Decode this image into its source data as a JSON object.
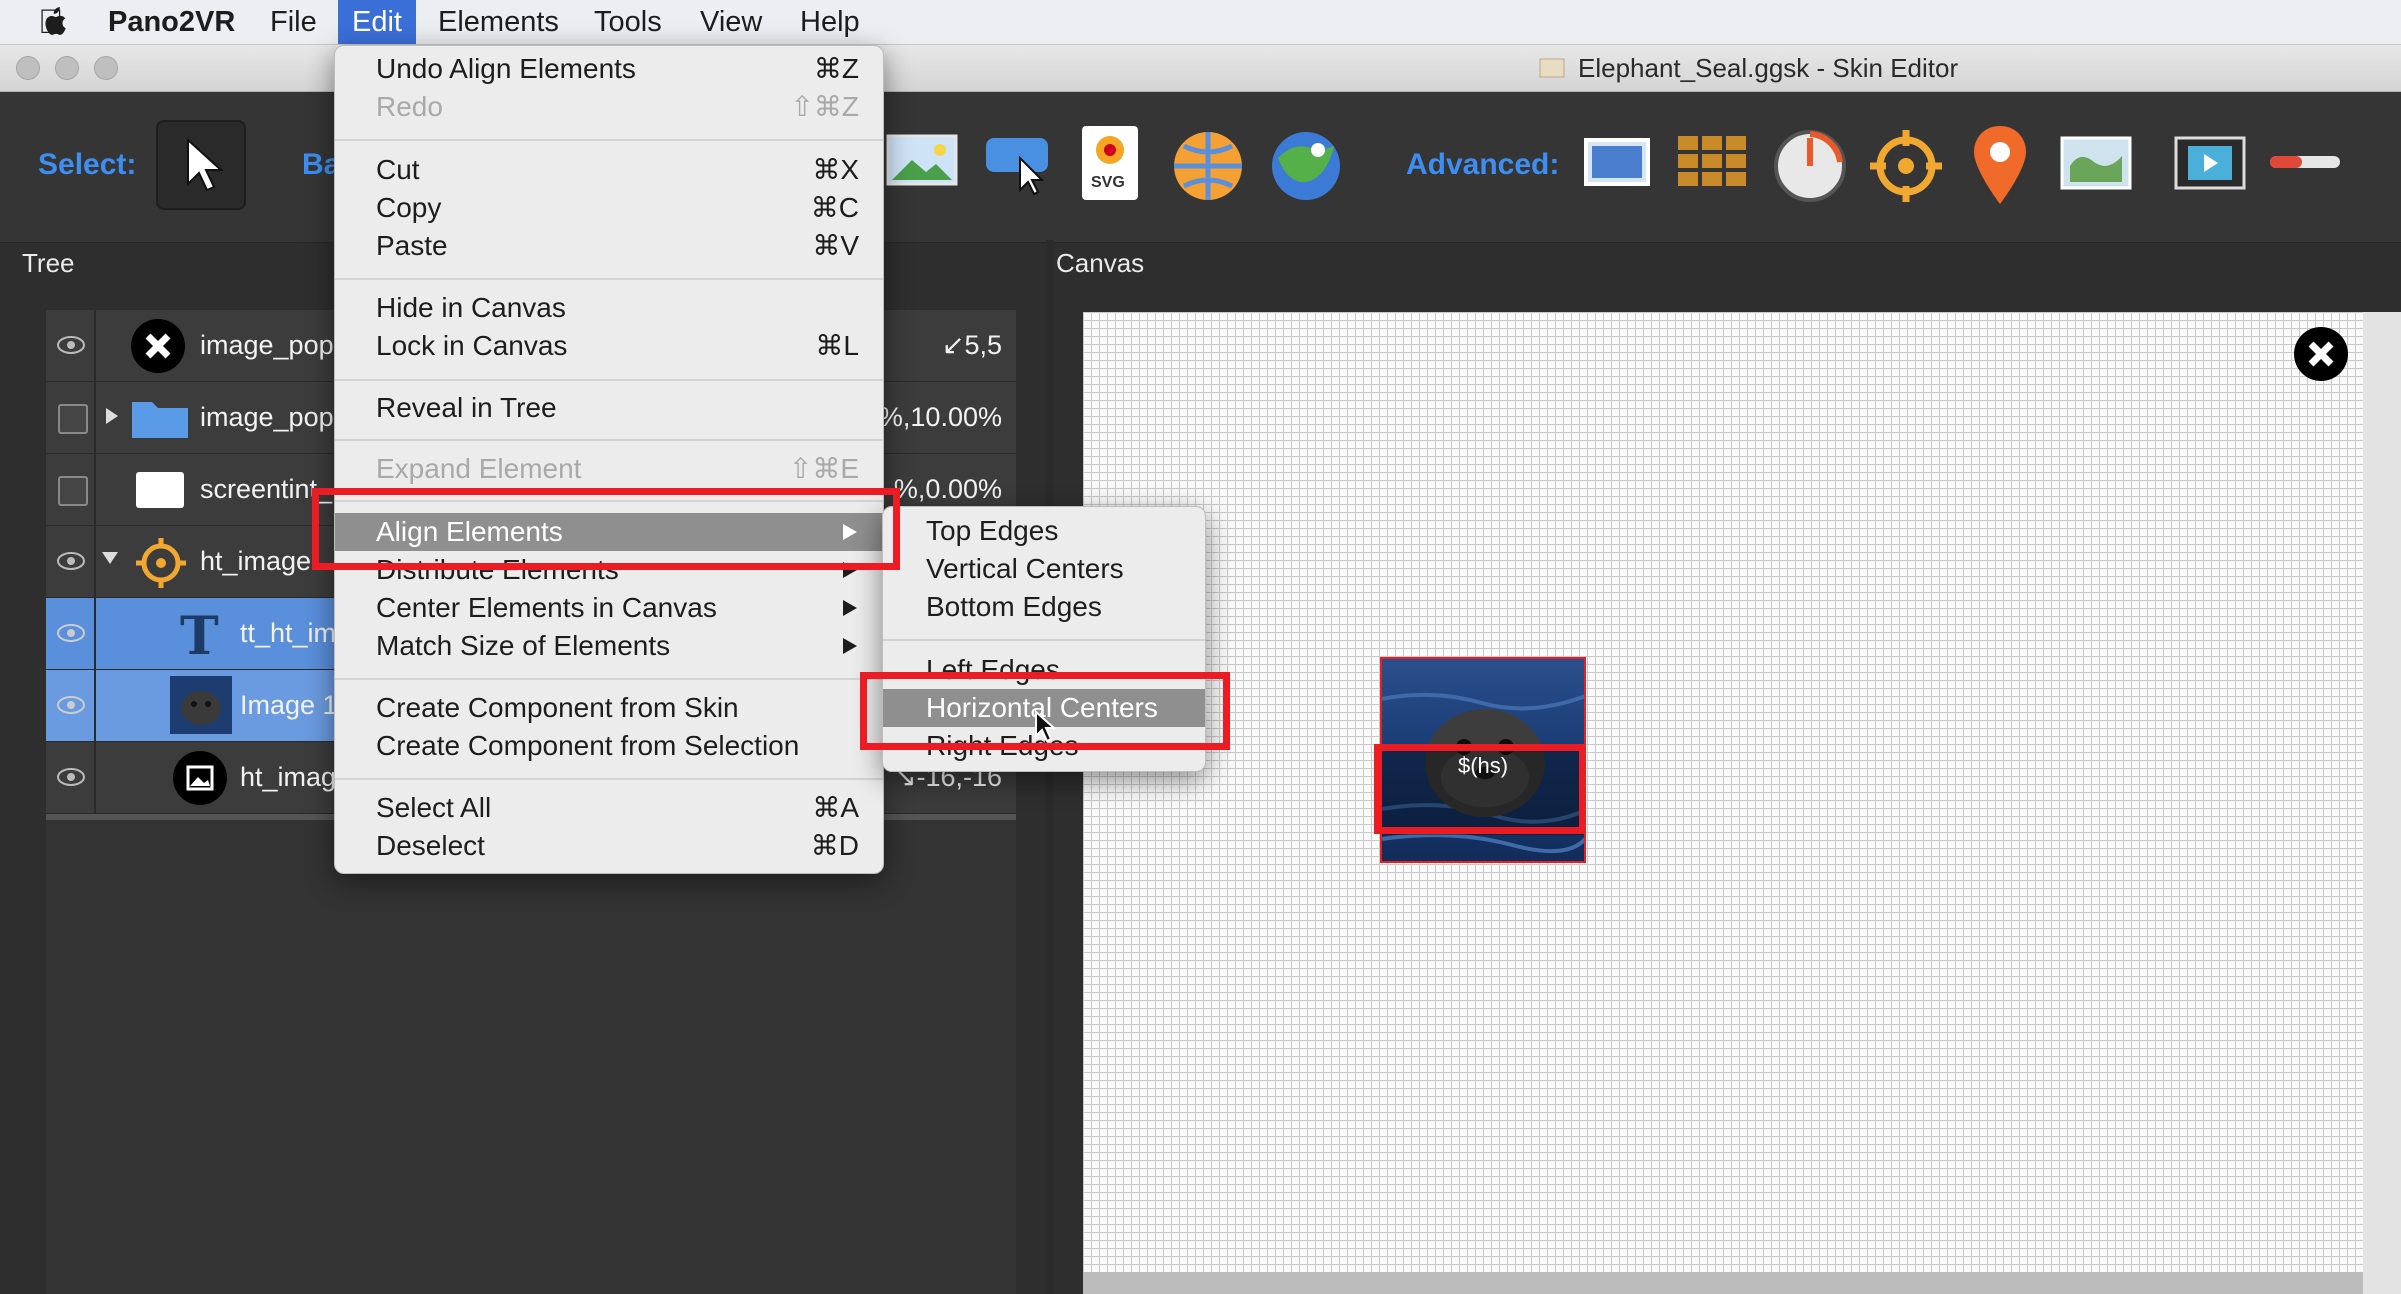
{
  "menubar": {
    "app": "Pano2VR",
    "items": [
      "File",
      "Edit",
      "Elements",
      "Tools",
      "View",
      "Help"
    ],
    "active": "Edit"
  },
  "window": {
    "title": "Elephant_Seal.ggsk - Skin Editor"
  },
  "toolbar": {
    "select_label": "Select:",
    "basic_label_partial": "Ba",
    "advanced_label": "Advanced:",
    "svg_tool_text": "SVG"
  },
  "panels": {
    "tree": "Tree",
    "canvas": "Canvas"
  },
  "tree_rows": [
    {
      "name": "image_popu",
      "value": "↙5,5",
      "visible": true
    },
    {
      "name": "image_popu",
      "value": "%,10.00%",
      "visible": false
    },
    {
      "name": "screentint_",
      "value": "%,0.00%",
      "visible": false
    },
    {
      "name": "ht_image",
      "value": "",
      "visible": true
    },
    {
      "name": "tt_ht_im",
      "value": "",
      "visible": true
    },
    {
      "name": "Image 1",
      "value": "",
      "visible": true
    },
    {
      "name": "ht_imag",
      "value": "↘-16,-16",
      "visible": true
    }
  ],
  "edit_menu": {
    "undo": {
      "label": "Undo Align Elements",
      "shortcut": "⌘Z"
    },
    "redo": {
      "label": "Redo",
      "shortcut": "⇧⌘Z"
    },
    "cut": {
      "label": "Cut",
      "shortcut": "⌘X"
    },
    "copy": {
      "label": "Copy",
      "shortcut": "⌘C"
    },
    "paste": {
      "label": "Paste",
      "shortcut": "⌘V"
    },
    "hide": {
      "label": "Hide in Canvas"
    },
    "lock": {
      "label": "Lock in Canvas",
      "shortcut": "⌘L"
    },
    "reveal": {
      "label": "Reveal in Tree"
    },
    "expand": {
      "label": "Expand Element",
      "shortcut": "⇧⌘E"
    },
    "align": {
      "label": "Align Elements"
    },
    "distribute": {
      "label": "Distribute Elements"
    },
    "center": {
      "label": "Center Elements in Canvas"
    },
    "match": {
      "label": "Match Size of Elements"
    },
    "comp_skin": {
      "label": "Create Component from Skin"
    },
    "comp_sel": {
      "label": "Create Component from Selection"
    },
    "select_all": {
      "label": "Select All",
      "shortcut": "⌘A"
    },
    "deselect": {
      "label": "Deselect",
      "shortcut": "⌘D"
    }
  },
  "align_submenu": {
    "top": "Top Edges",
    "vcenter": "Vertical Centers",
    "bottom": "Bottom Edges",
    "left": "Left Edges",
    "hcenter": "Horizontal Centers",
    "right": "Right Edges"
  },
  "canvas": {
    "hotspot_text": "$(hs)"
  },
  "colors": {
    "accent_blue": "#3d8ef2",
    "highlight_red": "#ec1c24",
    "selected_row": "#5a8fdb"
  }
}
